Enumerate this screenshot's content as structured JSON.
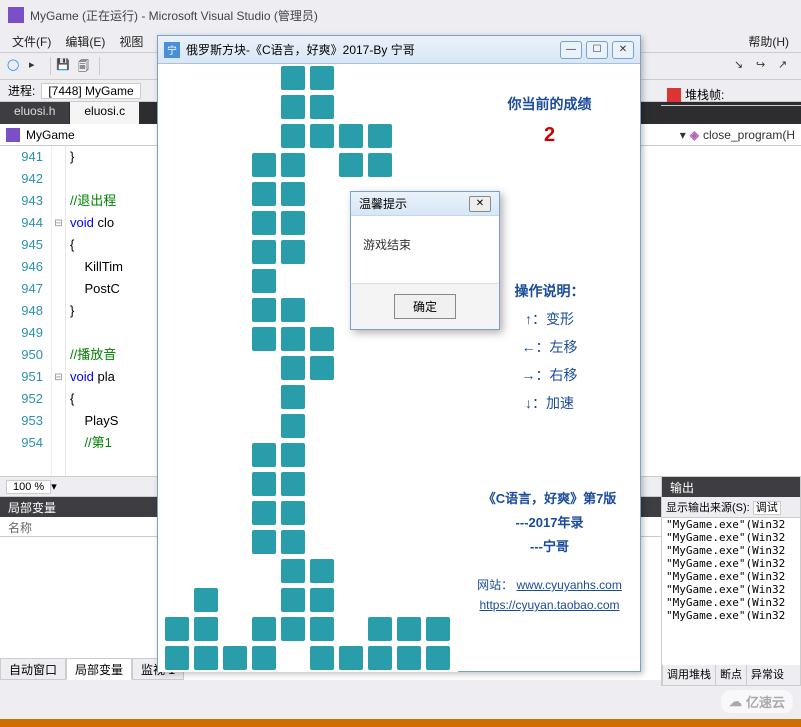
{
  "vs": {
    "title": "MyGame (正在运行) - Microsoft Visual Studio (管理员)",
    "menu": {
      "file": "文件(F)",
      "edit": "编辑(E)",
      "view": "视图",
      "help": "帮助(H)"
    },
    "process_label": "进程:",
    "process_value": "[7448] MyGame",
    "stack_label": "堆栈帧:",
    "tabs": {
      "eluosi_h": "eluosi.h",
      "eluosi_c": "eluosi.c"
    },
    "crumb_left": "MyGame",
    "crumb_right": "close_program(H",
    "zoom": "100 %"
  },
  "code": {
    "lines": [
      {
        "n": "941",
        "t": "}",
        "fold": ""
      },
      {
        "n": "942",
        "t": "",
        "fold": ""
      },
      {
        "n": "943",
        "t": "//退出程",
        "fold": "",
        "cls": "cm"
      },
      {
        "n": "944",
        "t": "void clo",
        "fold": "⊟",
        "kw": "void"
      },
      {
        "n": "945",
        "t": "{",
        "fold": ""
      },
      {
        "n": "946",
        "t": "    KillTim",
        "fold": ""
      },
      {
        "n": "947",
        "t": "    PostC",
        "fold": ""
      },
      {
        "n": "948",
        "t": "}",
        "fold": ""
      },
      {
        "n": "949",
        "t": "",
        "fold": ""
      },
      {
        "n": "950",
        "t": "//播放音",
        "fold": "",
        "cls": "cm"
      },
      {
        "n": "951",
        "t": "void pla",
        "fold": "⊟",
        "kw": "void"
      },
      {
        "n": "952",
        "t": "{",
        "fold": ""
      },
      {
        "n": "953",
        "t": "    PlayS",
        "fold": ""
      },
      {
        "n": "954",
        "t": "    //第1",
        "fold": "",
        "cls": "cm"
      }
    ]
  },
  "locals": {
    "title": "局部变量",
    "col_name": "名称",
    "bottom_tabs": {
      "auto": "自动窗口",
      "locals": "局部变量",
      "watch": "监视 1"
    }
  },
  "output": {
    "title": "输出",
    "head": "显示输出来源(S):",
    "head_combo": "调试",
    "lines": [
      "\"MyGame.exe\"(Win32",
      "\"MyGame.exe\"(Win32",
      "\"MyGame.exe\"(Win32",
      "\"MyGame.exe\"(Win32",
      "\"MyGame.exe\"(Win32",
      "\"MyGame.exe\"(Win32",
      "\"MyGame.exe\"(Win32",
      "\"MyGame.exe\"(Win32"
    ],
    "btabs": {
      "stack": "调用堆栈",
      "bp": "断点",
      "exc": "异常设"
    }
  },
  "game": {
    "title": "俄罗斯方块-《C语言，好爽》2017-By 宁哥",
    "icon_text": "宁",
    "score_label": "你当前的成绩",
    "score_value": "2",
    "instr_title": "操作说明：",
    "instr_up": "↑：变形",
    "instr_left": "←：左移",
    "instr_right": "→：右移",
    "instr_down": "↓：加速",
    "book_line1": "《C语言，好爽》第7版",
    "book_line2": "---2017年录",
    "book_line3": "---宁哥",
    "site_label": "网站：",
    "site_url": "www.cyuyanhs.com",
    "shop_url": "https://cyuyan.taobao.com",
    "cells": [
      [
        4,
        0
      ],
      [
        5,
        0
      ],
      [
        4,
        1
      ],
      [
        5,
        1
      ],
      [
        4,
        2
      ],
      [
        5,
        2
      ],
      [
        6,
        2
      ],
      [
        7,
        2
      ],
      [
        3,
        3
      ],
      [
        4,
        3
      ],
      [
        6,
        3
      ],
      [
        7,
        3
      ],
      [
        3,
        4
      ],
      [
        4,
        4
      ],
      [
        3,
        5
      ],
      [
        4,
        5
      ],
      [
        3,
        6
      ],
      [
        4,
        6
      ],
      [
        3,
        7
      ],
      [
        3,
        8
      ],
      [
        4,
        8
      ],
      [
        3,
        9
      ],
      [
        4,
        9
      ],
      [
        5,
        9
      ],
      [
        4,
        10
      ],
      [
        5,
        10
      ],
      [
        4,
        11
      ],
      [
        4,
        12
      ],
      [
        3,
        13
      ],
      [
        4,
        13
      ],
      [
        3,
        14
      ],
      [
        4,
        14
      ],
      [
        3,
        15
      ],
      [
        4,
        15
      ],
      [
        3,
        16
      ],
      [
        4,
        16
      ],
      [
        4,
        17
      ],
      [
        5,
        17
      ],
      [
        1,
        18
      ],
      [
        4,
        18
      ],
      [
        5,
        18
      ],
      [
        0,
        19
      ],
      [
        1,
        19
      ],
      [
        3,
        19
      ],
      [
        4,
        19
      ],
      [
        5,
        19
      ],
      [
        7,
        19
      ],
      [
        8,
        19
      ],
      [
        9,
        19
      ],
      [
        0,
        20
      ],
      [
        1,
        20
      ],
      [
        2,
        20
      ],
      [
        3,
        20
      ],
      [
        5,
        20
      ],
      [
        6,
        20
      ],
      [
        7,
        20
      ],
      [
        8,
        20
      ],
      [
        9,
        20
      ]
    ]
  },
  "dialog": {
    "title": "温馨提示",
    "message": "游戏结束",
    "ok": "确定"
  },
  "watermark": "亿速云"
}
